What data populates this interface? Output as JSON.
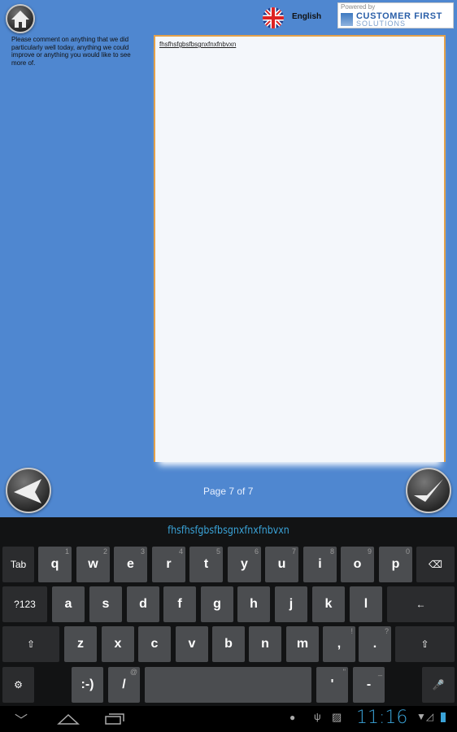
{
  "header": {
    "language": "English",
    "language_icon": "uk-flag-icon",
    "logo": {
      "powered_by": "Powered by",
      "line1": "CUSTOMER FIRST",
      "line2": "SOLUTIONS"
    }
  },
  "question": "Please comment on anything that we did particularly well today, anything we could improve or anything you would like to see more of.",
  "answer": "fhsfhsfgbsfbsgnxfnxfnbvxn",
  "pager": "Page 7 of 7",
  "keyboard": {
    "suggestion": "fhsfhsfgbsfbsgnxfnxfnbvxn",
    "rows": [
      [
        {
          "l": "Tab",
          "d": 1
        },
        {
          "l": "q",
          "h": "1"
        },
        {
          "l": "w",
          "h": "2"
        },
        {
          "l": "e",
          "h": "3"
        },
        {
          "l": "r",
          "h": "4"
        },
        {
          "l": "t",
          "h": "5"
        },
        {
          "l": "y",
          "h": "6"
        },
        {
          "l": "u",
          "h": "7"
        },
        {
          "l": "i",
          "h": "8"
        },
        {
          "l": "o",
          "h": "9"
        },
        {
          "l": "p",
          "h": "0"
        },
        {
          "l": "⌫",
          "d": 1
        }
      ],
      [
        {
          "l": "?123",
          "d": 1
        },
        {
          "l": "a"
        },
        {
          "l": "s"
        },
        {
          "l": "d"
        },
        {
          "l": "f"
        },
        {
          "l": "g"
        },
        {
          "l": "h"
        },
        {
          "l": "j"
        },
        {
          "l": "k"
        },
        {
          "l": "l"
        },
        {
          "l": "←",
          "d": 1
        }
      ],
      [
        {
          "l": "⇧",
          "d": 1
        },
        {
          "l": "z"
        },
        {
          "l": "x"
        },
        {
          "l": "c"
        },
        {
          "l": "v"
        },
        {
          "l": "b"
        },
        {
          "l": "n"
        },
        {
          "l": "m"
        },
        {
          "l": ",",
          "h": "!"
        },
        {
          "l": ".",
          "h": "?"
        },
        {
          "l": "⇧",
          "d": 1
        }
      ],
      [
        {
          "l": "⚙",
          "d": 1
        },
        {
          "l": ":-)"
        },
        {
          "l": "/",
          "h": "@"
        },
        {
          "l": ""
        },
        {
          "l": "'",
          "h": "\""
        },
        {
          "l": "-",
          "h": "_"
        },
        {
          "l": "🎤",
          "d": 1
        }
      ]
    ]
  },
  "status": {
    "time": "11:16"
  },
  "colors": {
    "background": "#4f87d0",
    "accent": "#3aa3d8",
    "border": "#e3a14a"
  }
}
